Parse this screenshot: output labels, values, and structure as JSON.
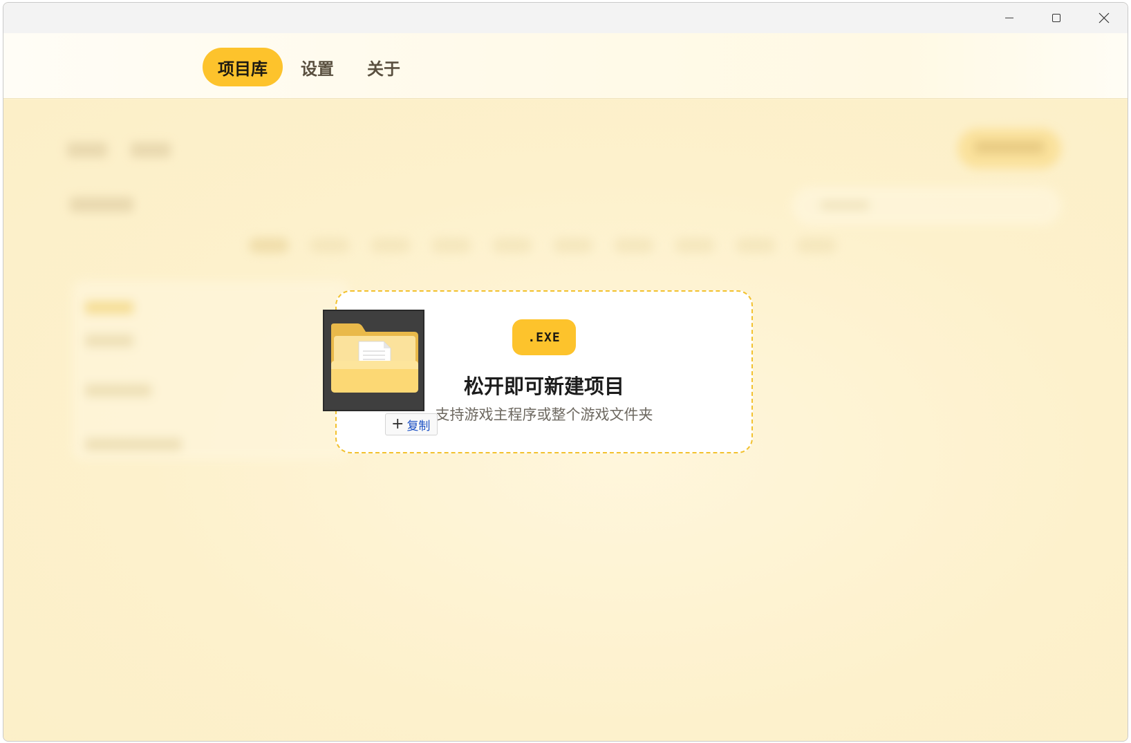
{
  "nav": {
    "tabs": [
      {
        "label": "项目库",
        "active": true
      },
      {
        "label": "设置",
        "active": false
      },
      {
        "label": "关于",
        "active": false
      }
    ]
  },
  "dropzone": {
    "badge": ".EXE",
    "title": "松开即可新建项目",
    "subtitle": "支持游戏主程序或整个游戏文件夹"
  },
  "drag": {
    "icon": "folder-icon",
    "tooltip_label": "复制"
  },
  "colors": {
    "accent": "#fdc32c",
    "background": "#fdf3d0",
    "dropzone_border": "#f2c12e",
    "tooltip_text": "#1a4fc4"
  }
}
